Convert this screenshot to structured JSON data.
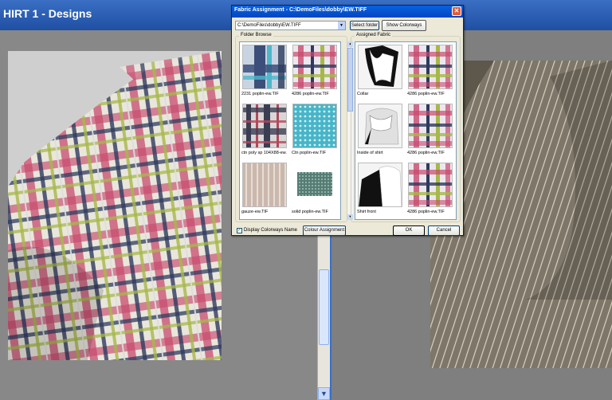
{
  "app": {
    "title": "HIRT 1 - Designs"
  },
  "dialog": {
    "title": "Fabric Assignment -  C:\\DemoFiles\\dobby\\EW.TIFF",
    "close_label": "✕",
    "path_value": "C:\\DemoFiles\\dobby\\EW.TIFF",
    "select_folder_label": "Select folder",
    "show_colorways_label": "Show Colorways",
    "folder_browse_label": "Folder Browse",
    "assigned_fabric_label": "Assigned Fabric",
    "folder_items": [
      {
        "label": "2231 poplin-ew.TIF"
      },
      {
        "label": "4286 poplin-ew.TIF"
      },
      {
        "label": "ctn poly sp 104X88-ew."
      },
      {
        "label": "Ctn poplin-ew.TIF"
      },
      {
        "label": "gauze-ew.TIF"
      },
      {
        "label": "solid poplin-ew.TIF"
      }
    ],
    "assigned_items": [
      {
        "part": "Collar",
        "fabric": "4286 poplin-ew.TIF"
      },
      {
        "part": "Inside of shirt",
        "fabric": "4286 poplin-ew.TIF"
      },
      {
        "part": "Shirt front",
        "fabric": "4286 poplin-ew.TIF"
      }
    ],
    "display_colorways_checked": true,
    "display_colorways_label": "Display Colorways Name",
    "colour_assignment_label": "Colour Assignment",
    "ok_label": "OK",
    "cancel_label": "Cancel"
  },
  "icons": {
    "close": "close-icon",
    "combo_arrow": "chevron-down-icon",
    "scroll_up": "chevron-up-icon",
    "scroll_down": "chevron-down-icon"
  },
  "colors": {
    "title_bar": "#0346c0",
    "dialog_bg": "#ece9d8",
    "plaid_pink": "#c84a6e",
    "plaid_navy": "#2e3a5e",
    "plaid_green": "#a6b84a",
    "stripe_bg": "#7e7668"
  }
}
